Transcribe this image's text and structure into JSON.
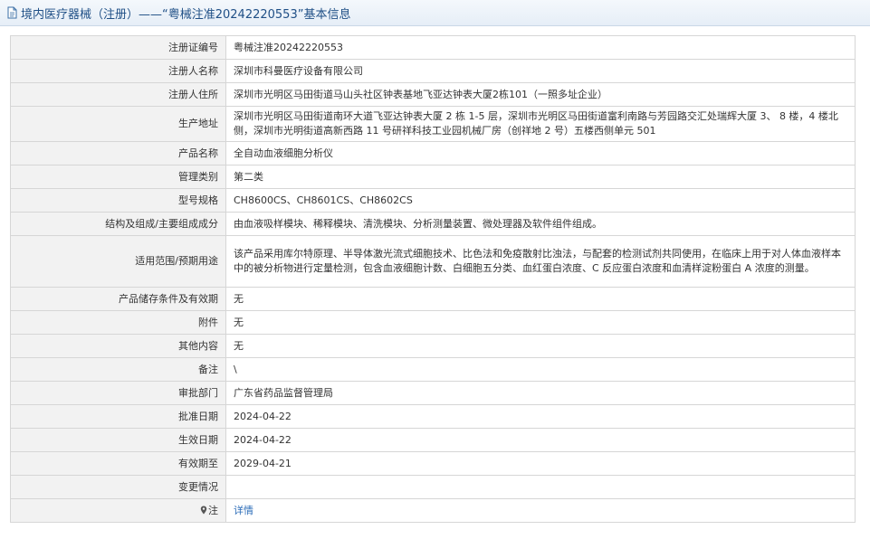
{
  "header": {
    "title": "境内医疗器械（注册）——“粤械注准20242220553”基本信息"
  },
  "rows": [
    {
      "label": "注册证编号",
      "value": "粤械注准20242220553"
    },
    {
      "label": "注册人名称",
      "value": "深圳市科曼医疗设备有限公司"
    },
    {
      "label": "注册人住所",
      "value": "深圳市光明区马田街道马山头社区钟表基地飞亚达钟表大厦2栋101（一照多址企业）"
    },
    {
      "label": "生产地址",
      "value": "深圳市光明区马田街道南环大道飞亚达钟表大厦 2 栋 1-5 层，深圳市光明区马田街道富利南路与芳园路交汇处瑞辉大厦 3、 8 楼，4 楼北侧，深圳市光明街道高新西路 11 号研祥科技工业园机械厂房（创祥地 2 号）五楼西侧单元 501"
    },
    {
      "label": "产品名称",
      "value": "全自动血液细胞分析仪"
    },
    {
      "label": "管理类别",
      "value": "第二类"
    },
    {
      "label": "型号规格",
      "value": "CH8600CS、CH8601CS、CH8602CS"
    },
    {
      "label": "结构及组成/主要组成成分",
      "value": "由血液吸样模块、稀释模块、清洗模块、分析测量装置、微处理器及软件组件组成。"
    },
    {
      "label": "适用范围/预期用途",
      "value": "该产品采用库尔特原理、半导体激光流式细胞技术、比色法和免疫散射比浊法，与配套的检测试剂共同使用，在临床上用于对人体血液样本中的被分析物进行定量检测，包含血液细胞计数、白细胞五分类、血红蛋白浓度、C 反应蛋白浓度和血清样淀粉蛋白 A 浓度的测量。"
    },
    {
      "label": "产品储存条件及有效期",
      "value": "无"
    },
    {
      "label": "附件",
      "value": "无"
    },
    {
      "label": "其他内容",
      "value": "无"
    },
    {
      "label": "备注",
      "value": "\\"
    },
    {
      "label": "审批部门",
      "value": "广东省药品监督管理局"
    },
    {
      "label": "批准日期",
      "value": "2024-04-22"
    },
    {
      "label": "生效日期",
      "value": "2024-04-22"
    },
    {
      "label": "有效期至",
      "value": "2029-04-21"
    },
    {
      "label": "变更情况",
      "value": ""
    }
  ],
  "note": {
    "label": "注",
    "link_text": "详情"
  },
  "colors": {
    "title_text": "#1f4f86",
    "label_bg": "#f2f2f2",
    "border": "#d6d6d6",
    "link": "#2b6cb8"
  },
  "icons": {
    "title": "document-icon",
    "note": "location-pin-icon"
  }
}
